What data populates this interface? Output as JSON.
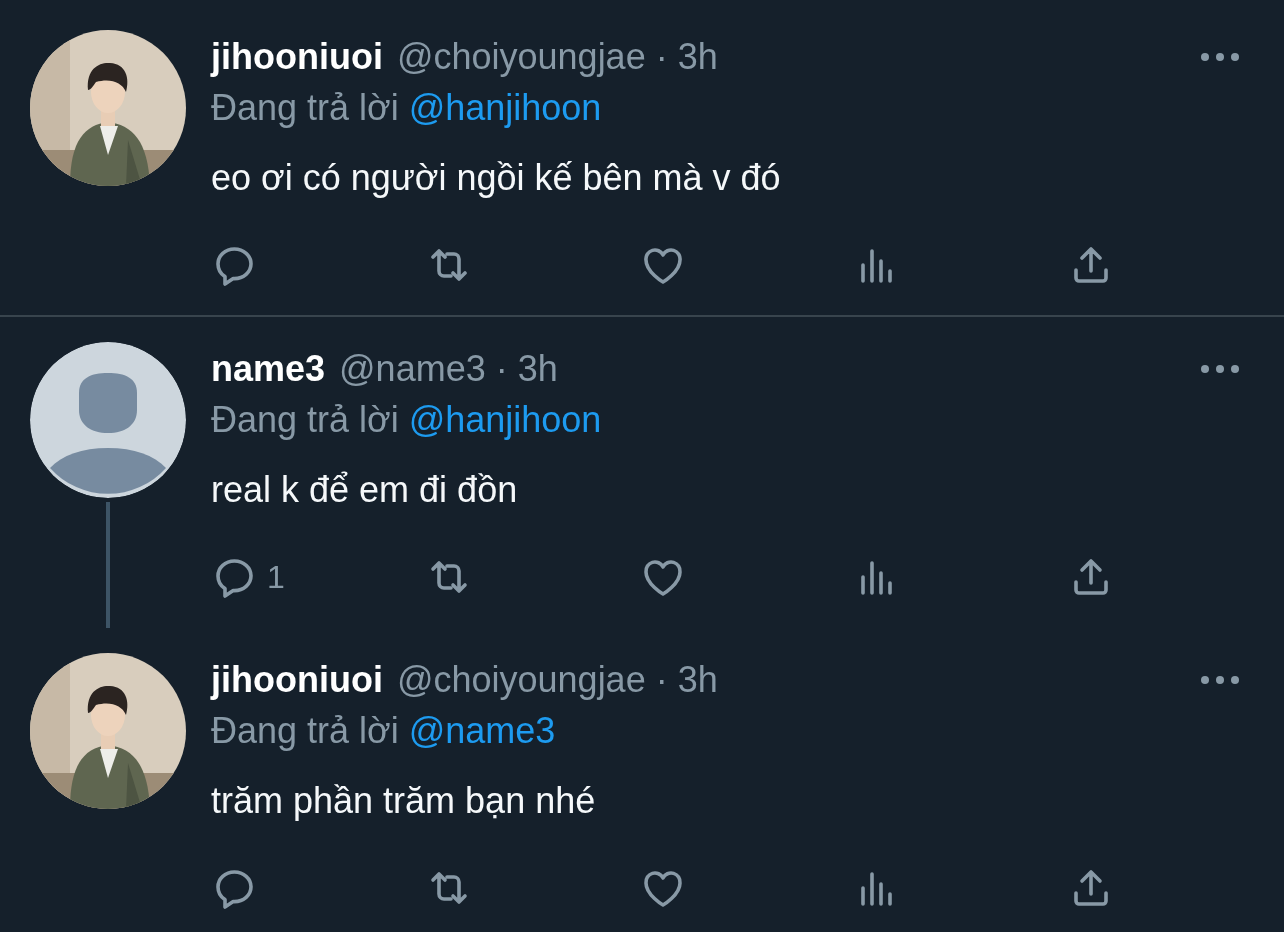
{
  "tweets": [
    {
      "name": "jihooniuoi",
      "meta": "@choiyoungjae · 3h",
      "reply_label": "Đang trả lời",
      "reply_to": "@hanjihoon",
      "text": "eo ơi có người ngồi kế bên mà v đó",
      "thread_line": false,
      "divider": true
    },
    {
      "avatar": {
        "kind": "default"
      },
      "name": "name3",
      "meta": "@name3 · 3h",
      "reply_label": "Đang trả lời",
      "reply_to": "@hanjihoon",
      "text": "real k để em đi đồn",
      "reply_count": "1",
      "thread_line": true,
      "divider": false
    },
    {
      "name": "jihooniuoi",
      "meta": "@choiyoungjae · 3h",
      "reply_label": "Đang trả lời",
      "reply_to": "@name3",
      "text": "trăm phần trăm bạn nhé",
      "thread_line": false,
      "divider": false
    }
  ]
}
